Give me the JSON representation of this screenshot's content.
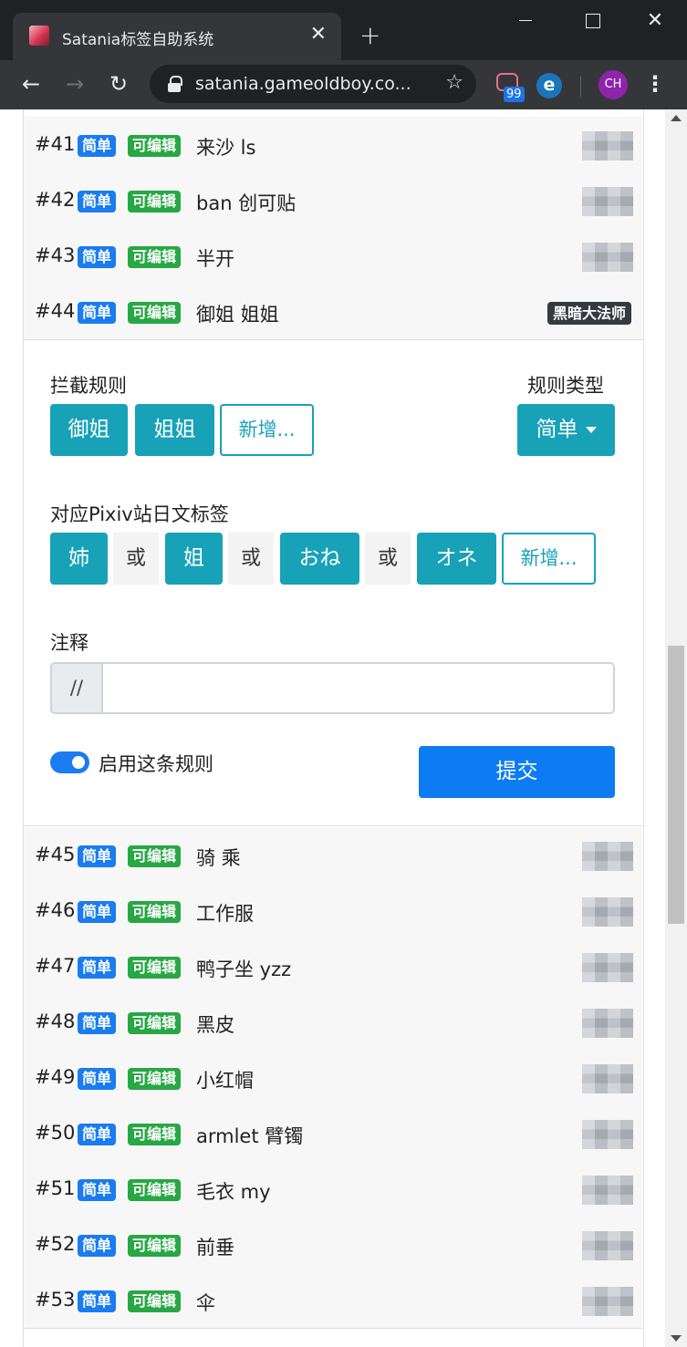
{
  "browser": {
    "tab_title": "Satania标签自助系统",
    "tab_close": "✕",
    "new_tab": "+",
    "url": "satania.gameoldboy.co...",
    "extension_badge": "99",
    "profile_initials": "CH"
  },
  "rules": [
    {
      "num": "#41",
      "type": "简单",
      "editable": "可编辑",
      "name": "来沙 ls"
    },
    {
      "num": "#42",
      "type": "简单",
      "editable": "可编辑",
      "name": "ban 创可贴"
    },
    {
      "num": "#43",
      "type": "简单",
      "editable": "可编辑",
      "name": "半开"
    },
    {
      "num": "#44",
      "type": "简单",
      "editable": "可编辑",
      "name": "御姐 姐姐",
      "author_tag": "黑暗大法师"
    },
    {
      "num": "#45",
      "type": "简单",
      "editable": "可编辑",
      "name": "骑 乘"
    },
    {
      "num": "#46",
      "type": "简单",
      "editable": "可编辑",
      "name": "工作服"
    },
    {
      "num": "#47",
      "type": "简单",
      "editable": "可编辑",
      "name": "鸭子坐 yzz"
    },
    {
      "num": "#48",
      "type": "简单",
      "editable": "可编辑",
      "name": "黑皮"
    },
    {
      "num": "#49",
      "type": "简单",
      "editable": "可编辑",
      "name": "小红帽"
    },
    {
      "num": "#50",
      "type": "简单",
      "editable": "可编辑",
      "name": "armlet 臂镯"
    },
    {
      "num": "#51",
      "type": "简单",
      "editable": "可编辑",
      "name": "毛衣 my"
    },
    {
      "num": "#52",
      "type": "简单",
      "editable": "可编辑",
      "name": "前垂"
    },
    {
      "num": "#53",
      "type": "简单",
      "editable": "可编辑",
      "name": "伞"
    }
  ],
  "detail": {
    "intercept_label": "拦截规则",
    "intercept_tags": [
      "御姐",
      "姐姐"
    ],
    "add_label": "新增...",
    "rule_type_label": "规则类型",
    "rule_type_value": "简单",
    "pixiv_label": "对应Pixiv站日文标签",
    "pixiv_tags": [
      "姉",
      "姐",
      "おね",
      "オネ"
    ],
    "or_text": "或",
    "comment_label": "注释",
    "comment_prefix": "//",
    "comment_value": "",
    "enable_label": "启用这条规则",
    "enabled": true,
    "submit_label": "提交"
  }
}
